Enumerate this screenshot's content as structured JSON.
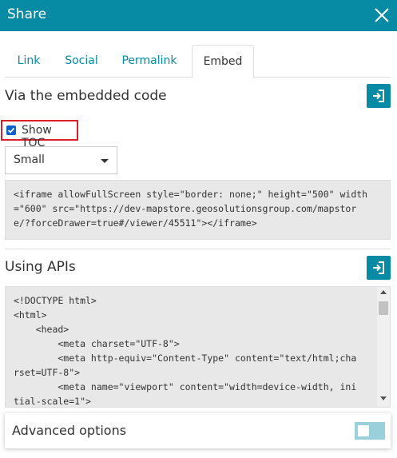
{
  "header": {
    "title": "Share"
  },
  "tabs": [
    {
      "label": "Link"
    },
    {
      "label": "Social"
    },
    {
      "label": "Permalink"
    },
    {
      "label": "Embed"
    }
  ],
  "active_tab": "Embed",
  "embed_section": {
    "title": "Via the embedded code",
    "show_toc_label": "Show TOC",
    "show_toc_checked": true,
    "size_select_value": "Small",
    "code_lines": [
      "<iframe allowFullScreen style=\"border: none;\" height=\"500\" width",
      "=\"600\" src=\"https://dev-mapstore.geosolutionsgroup.com/mapstor",
      "e/?forceDrawer=true#/viewer/45511\"></iframe>"
    ]
  },
  "api_section": {
    "title": "Using APIs",
    "code_lines": [
      "<!DOCTYPE html>",
      "<html>",
      "    <head>",
      "        <meta charset=\"UTF-8\">",
      "        <meta http-equiv=\"Content-Type\" content=\"text/html;cha",
      "rset=UTF-8\">",
      "        <meta name=\"viewport\" content=\"width=device-width, ini",
      "tial-scale=1\">"
    ]
  },
  "advanced_options": {
    "label": "Advanced options",
    "enabled": false
  },
  "colors": {
    "brand": "#078aa3",
    "highlight_border": "#d9202a",
    "checkbox": "#0a62c9"
  }
}
